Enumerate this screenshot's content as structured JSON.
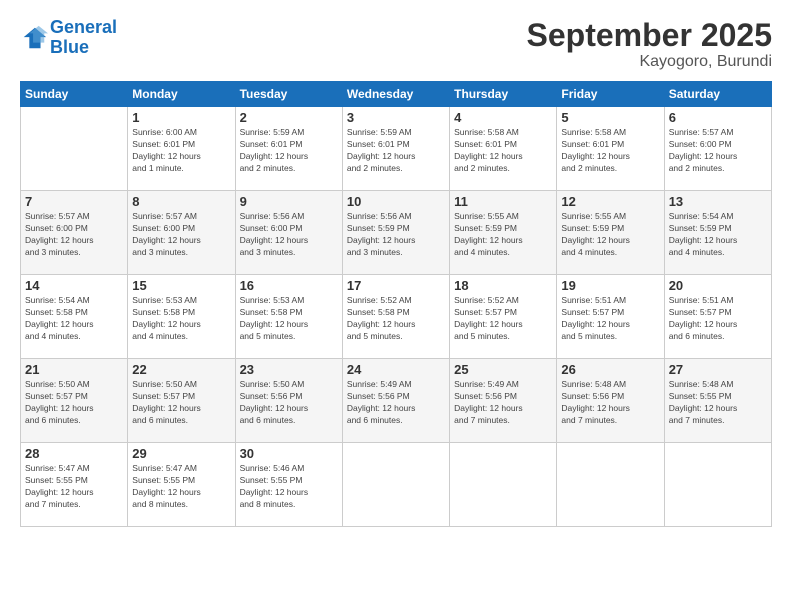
{
  "logo": {
    "line1": "General",
    "line2": "Blue"
  },
  "title": "September 2025",
  "location": "Kayogoro, Burundi",
  "days_header": [
    "Sunday",
    "Monday",
    "Tuesday",
    "Wednesday",
    "Thursday",
    "Friday",
    "Saturday"
  ],
  "weeks": [
    [
      {
        "day": "",
        "info": ""
      },
      {
        "day": "1",
        "info": "Sunrise: 6:00 AM\nSunset: 6:01 PM\nDaylight: 12 hours\nand 1 minute."
      },
      {
        "day": "2",
        "info": "Sunrise: 5:59 AM\nSunset: 6:01 PM\nDaylight: 12 hours\nand 2 minutes."
      },
      {
        "day": "3",
        "info": "Sunrise: 5:59 AM\nSunset: 6:01 PM\nDaylight: 12 hours\nand 2 minutes."
      },
      {
        "day": "4",
        "info": "Sunrise: 5:58 AM\nSunset: 6:01 PM\nDaylight: 12 hours\nand 2 minutes."
      },
      {
        "day": "5",
        "info": "Sunrise: 5:58 AM\nSunset: 6:01 PM\nDaylight: 12 hours\nand 2 minutes."
      },
      {
        "day": "6",
        "info": "Sunrise: 5:57 AM\nSunset: 6:00 PM\nDaylight: 12 hours\nand 2 minutes."
      }
    ],
    [
      {
        "day": "7",
        "info": "Sunrise: 5:57 AM\nSunset: 6:00 PM\nDaylight: 12 hours\nand 3 minutes."
      },
      {
        "day": "8",
        "info": "Sunrise: 5:57 AM\nSunset: 6:00 PM\nDaylight: 12 hours\nand 3 minutes."
      },
      {
        "day": "9",
        "info": "Sunrise: 5:56 AM\nSunset: 6:00 PM\nDaylight: 12 hours\nand 3 minutes."
      },
      {
        "day": "10",
        "info": "Sunrise: 5:56 AM\nSunset: 5:59 PM\nDaylight: 12 hours\nand 3 minutes."
      },
      {
        "day": "11",
        "info": "Sunrise: 5:55 AM\nSunset: 5:59 PM\nDaylight: 12 hours\nand 4 minutes."
      },
      {
        "day": "12",
        "info": "Sunrise: 5:55 AM\nSunset: 5:59 PM\nDaylight: 12 hours\nand 4 minutes."
      },
      {
        "day": "13",
        "info": "Sunrise: 5:54 AM\nSunset: 5:59 PM\nDaylight: 12 hours\nand 4 minutes."
      }
    ],
    [
      {
        "day": "14",
        "info": "Sunrise: 5:54 AM\nSunset: 5:58 PM\nDaylight: 12 hours\nand 4 minutes."
      },
      {
        "day": "15",
        "info": "Sunrise: 5:53 AM\nSunset: 5:58 PM\nDaylight: 12 hours\nand 4 minutes."
      },
      {
        "day": "16",
        "info": "Sunrise: 5:53 AM\nSunset: 5:58 PM\nDaylight: 12 hours\nand 5 minutes."
      },
      {
        "day": "17",
        "info": "Sunrise: 5:52 AM\nSunset: 5:58 PM\nDaylight: 12 hours\nand 5 minutes."
      },
      {
        "day": "18",
        "info": "Sunrise: 5:52 AM\nSunset: 5:57 PM\nDaylight: 12 hours\nand 5 minutes."
      },
      {
        "day": "19",
        "info": "Sunrise: 5:51 AM\nSunset: 5:57 PM\nDaylight: 12 hours\nand 5 minutes."
      },
      {
        "day": "20",
        "info": "Sunrise: 5:51 AM\nSunset: 5:57 PM\nDaylight: 12 hours\nand 6 minutes."
      }
    ],
    [
      {
        "day": "21",
        "info": "Sunrise: 5:50 AM\nSunset: 5:57 PM\nDaylight: 12 hours\nand 6 minutes."
      },
      {
        "day": "22",
        "info": "Sunrise: 5:50 AM\nSunset: 5:57 PM\nDaylight: 12 hours\nand 6 minutes."
      },
      {
        "day": "23",
        "info": "Sunrise: 5:50 AM\nSunset: 5:56 PM\nDaylight: 12 hours\nand 6 minutes."
      },
      {
        "day": "24",
        "info": "Sunrise: 5:49 AM\nSunset: 5:56 PM\nDaylight: 12 hours\nand 6 minutes."
      },
      {
        "day": "25",
        "info": "Sunrise: 5:49 AM\nSunset: 5:56 PM\nDaylight: 12 hours\nand 7 minutes."
      },
      {
        "day": "26",
        "info": "Sunrise: 5:48 AM\nSunset: 5:56 PM\nDaylight: 12 hours\nand 7 minutes."
      },
      {
        "day": "27",
        "info": "Sunrise: 5:48 AM\nSunset: 5:55 PM\nDaylight: 12 hours\nand 7 minutes."
      }
    ],
    [
      {
        "day": "28",
        "info": "Sunrise: 5:47 AM\nSunset: 5:55 PM\nDaylight: 12 hours\nand 7 minutes."
      },
      {
        "day": "29",
        "info": "Sunrise: 5:47 AM\nSunset: 5:55 PM\nDaylight: 12 hours\nand 8 minutes."
      },
      {
        "day": "30",
        "info": "Sunrise: 5:46 AM\nSunset: 5:55 PM\nDaylight: 12 hours\nand 8 minutes."
      },
      {
        "day": "",
        "info": ""
      },
      {
        "day": "",
        "info": ""
      },
      {
        "day": "",
        "info": ""
      },
      {
        "day": "",
        "info": ""
      }
    ]
  ]
}
